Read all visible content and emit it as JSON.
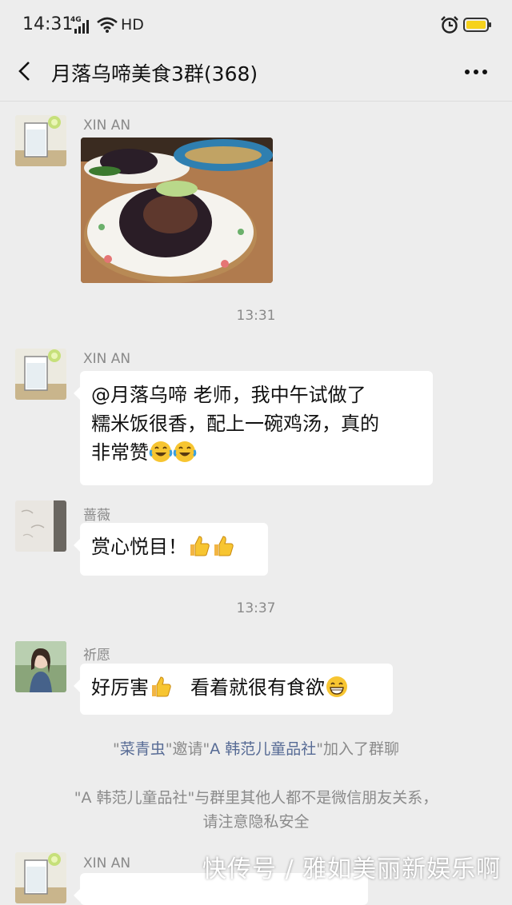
{
  "status_bar": {
    "time": "14:31",
    "network": "4G",
    "hd": "HD"
  },
  "header": {
    "title": "月落乌啼美食3群(368)"
  },
  "messages": [
    {
      "sender": "XIN AN"
    },
    {
      "sender": "XIN AN",
      "text_lines": [
        "@月落乌啼  老师，我中午试做了",
        "糯米饭很香，配上一碗鸡汤，真的",
        "非常赞"
      ]
    },
    {
      "sender": "蔷薇",
      "text": "赏心悦目！"
    },
    {
      "sender": "祈愿",
      "text_a": "好厉害",
      "text_b": "看着就很有食欲"
    },
    {
      "sender": "XIN AN"
    }
  ],
  "timestamps": [
    "13:31",
    "13:37"
  ],
  "system": {
    "invite": {
      "inviter": "菜青虫",
      "verb": "邀请",
      "invitee": "A 韩范儿童品社",
      "suffix": "加入了群聊"
    },
    "privacy_lines": [
      "\"A 韩范儿童品社\"与群里其他人都不是微信朋友关系，",
      "请注意隐私安全"
    ]
  },
  "watermark": "快传号 / 雅如美丽新娱乐啊",
  "colors": {
    "background": "#ededed",
    "bubble": "#ffffff",
    "link": "#576b95",
    "battery": "#f6d21c"
  }
}
